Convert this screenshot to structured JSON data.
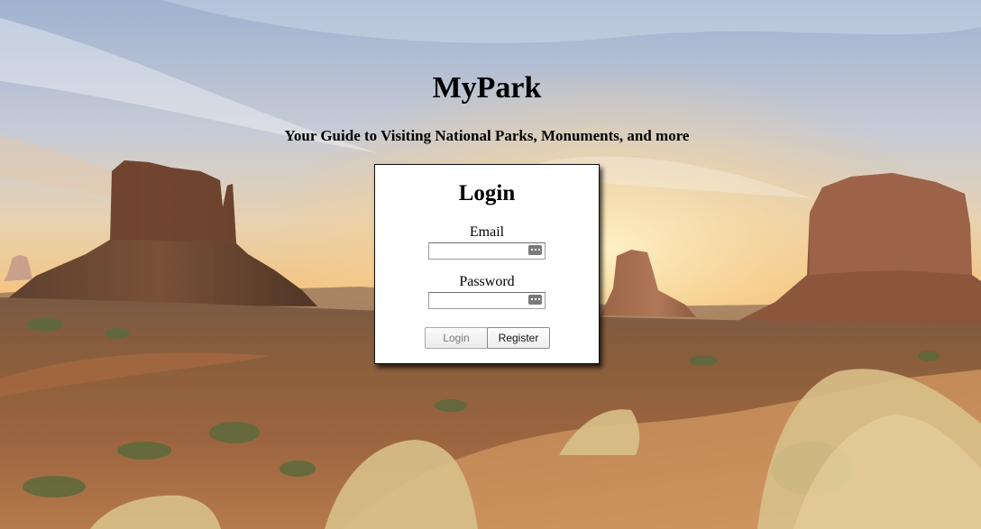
{
  "header": {
    "title": "MyPark",
    "tagline": "Your Guide to Visiting National Parks, Monuments, and more"
  },
  "login": {
    "title": "Login",
    "email_label": "Email",
    "email_value": "",
    "password_label": "Password",
    "password_value": "",
    "login_button": "Login",
    "register_button": "Register"
  },
  "background": {
    "icon": "desert-landscape-image",
    "sky_top": "#9fb4d4",
    "horizon": "#f2c98a",
    "ground": "#8a5a3a"
  }
}
